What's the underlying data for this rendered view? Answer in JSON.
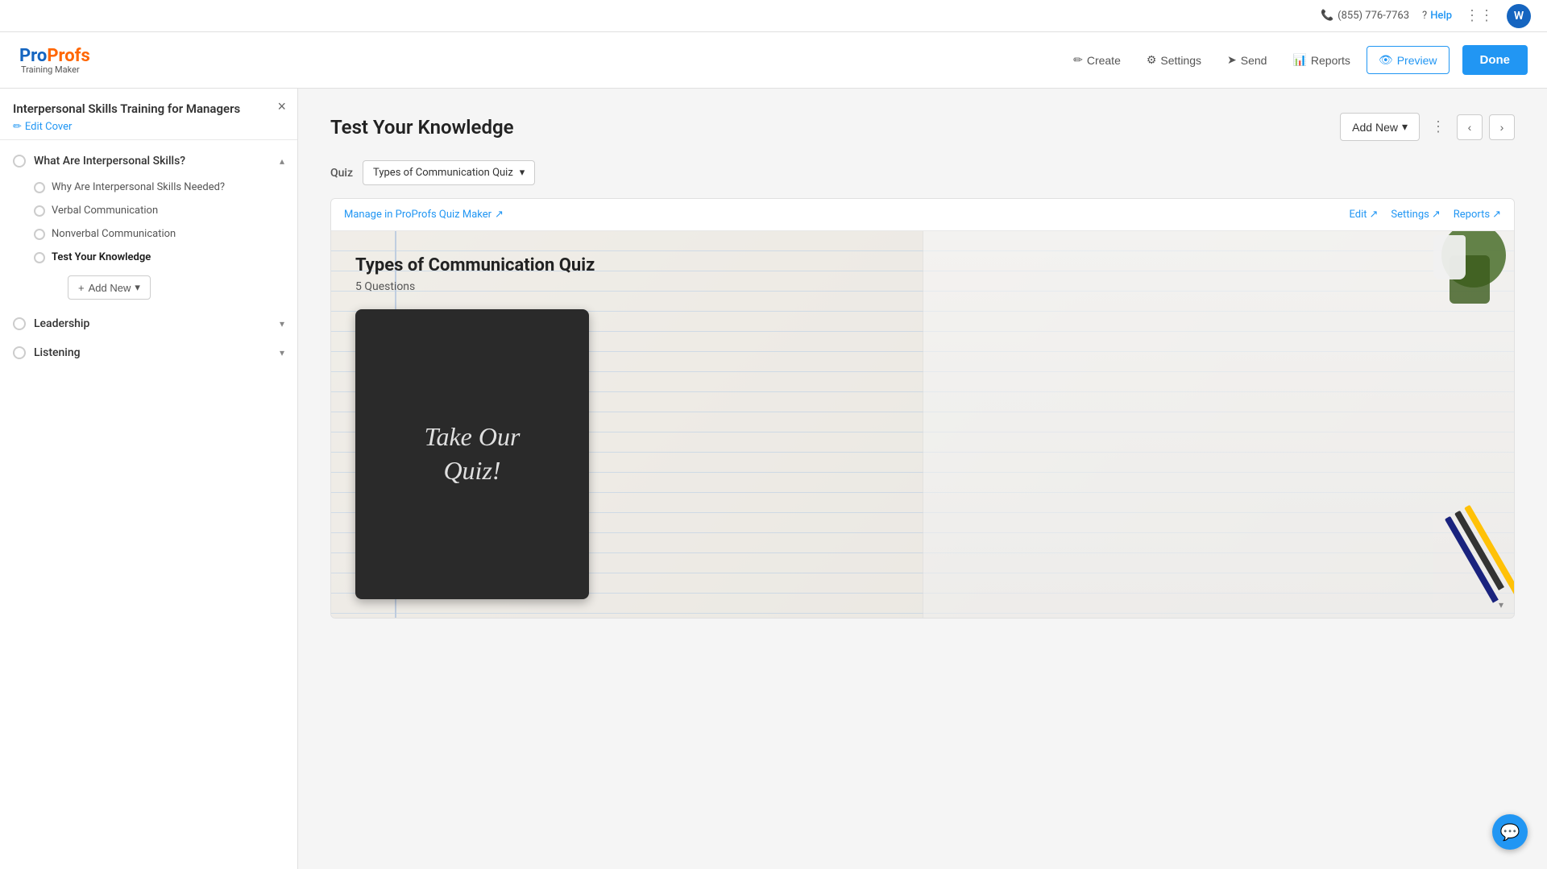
{
  "topbar": {
    "phone": "(855) 776-7763",
    "help_label": "Help",
    "avatar_letter": "W"
  },
  "header": {
    "logo_pro": "Pro",
    "logo_profs": "Profs",
    "logo_sub": "Training Maker",
    "create_label": "Create",
    "settings_label": "Settings",
    "send_label": "Send",
    "reports_label": "Reports",
    "preview_label": "Preview",
    "done_label": "Done"
  },
  "sidebar": {
    "title": "Interpersonal Skills Training for Managers",
    "edit_cover_label": "Edit Cover",
    "close_label": "×",
    "chapters": [
      {
        "id": "ch1",
        "label": "What Are Interpersonal Skills?",
        "expanded": true,
        "radio_active": false,
        "sub_items": [
          {
            "label": "Why Are Interpersonal Skills Needed?",
            "active": false
          },
          {
            "label": "Verbal Communication",
            "active": false
          },
          {
            "label": "Nonverbal Communication",
            "active": false
          },
          {
            "label": "Test Your Knowledge",
            "active": true
          }
        ],
        "add_new_label": "Add New"
      },
      {
        "id": "ch2",
        "label": "Leadership",
        "expanded": false,
        "radio_active": false,
        "sub_items": []
      },
      {
        "id": "ch3",
        "label": "Listening",
        "expanded": false,
        "radio_active": false,
        "sub_items": []
      }
    ]
  },
  "content": {
    "page_title": "Test Your Knowledge",
    "add_new_label": "Add New",
    "quiz_label": "Quiz",
    "quiz_select_value": "Types of Communication Quiz",
    "manage_link": "Manage in ProProfs Quiz Maker",
    "quiz_actions": {
      "edit_label": "Edit",
      "settings_label": "Settings",
      "reports_label": "Reports"
    },
    "quiz_preview": {
      "title": "Types of Communication Quiz",
      "questions": "5 Questions",
      "blackboard_line1": "Take Our",
      "blackboard_line2": "Quiz!"
    }
  },
  "icons": {
    "pencil": "✏",
    "phone": "📞",
    "question": "?",
    "grid": "⋮⋮",
    "create": "✏",
    "settings": "⚙",
    "send": "➤",
    "reports": "📊",
    "preview": "👁",
    "chevron_down": "▾",
    "chevron_up": "▴",
    "chevron_left": "‹",
    "chevron_right": "›",
    "external": "↗",
    "dropdown": "▾",
    "dots": "⋮",
    "chat": "💬"
  }
}
